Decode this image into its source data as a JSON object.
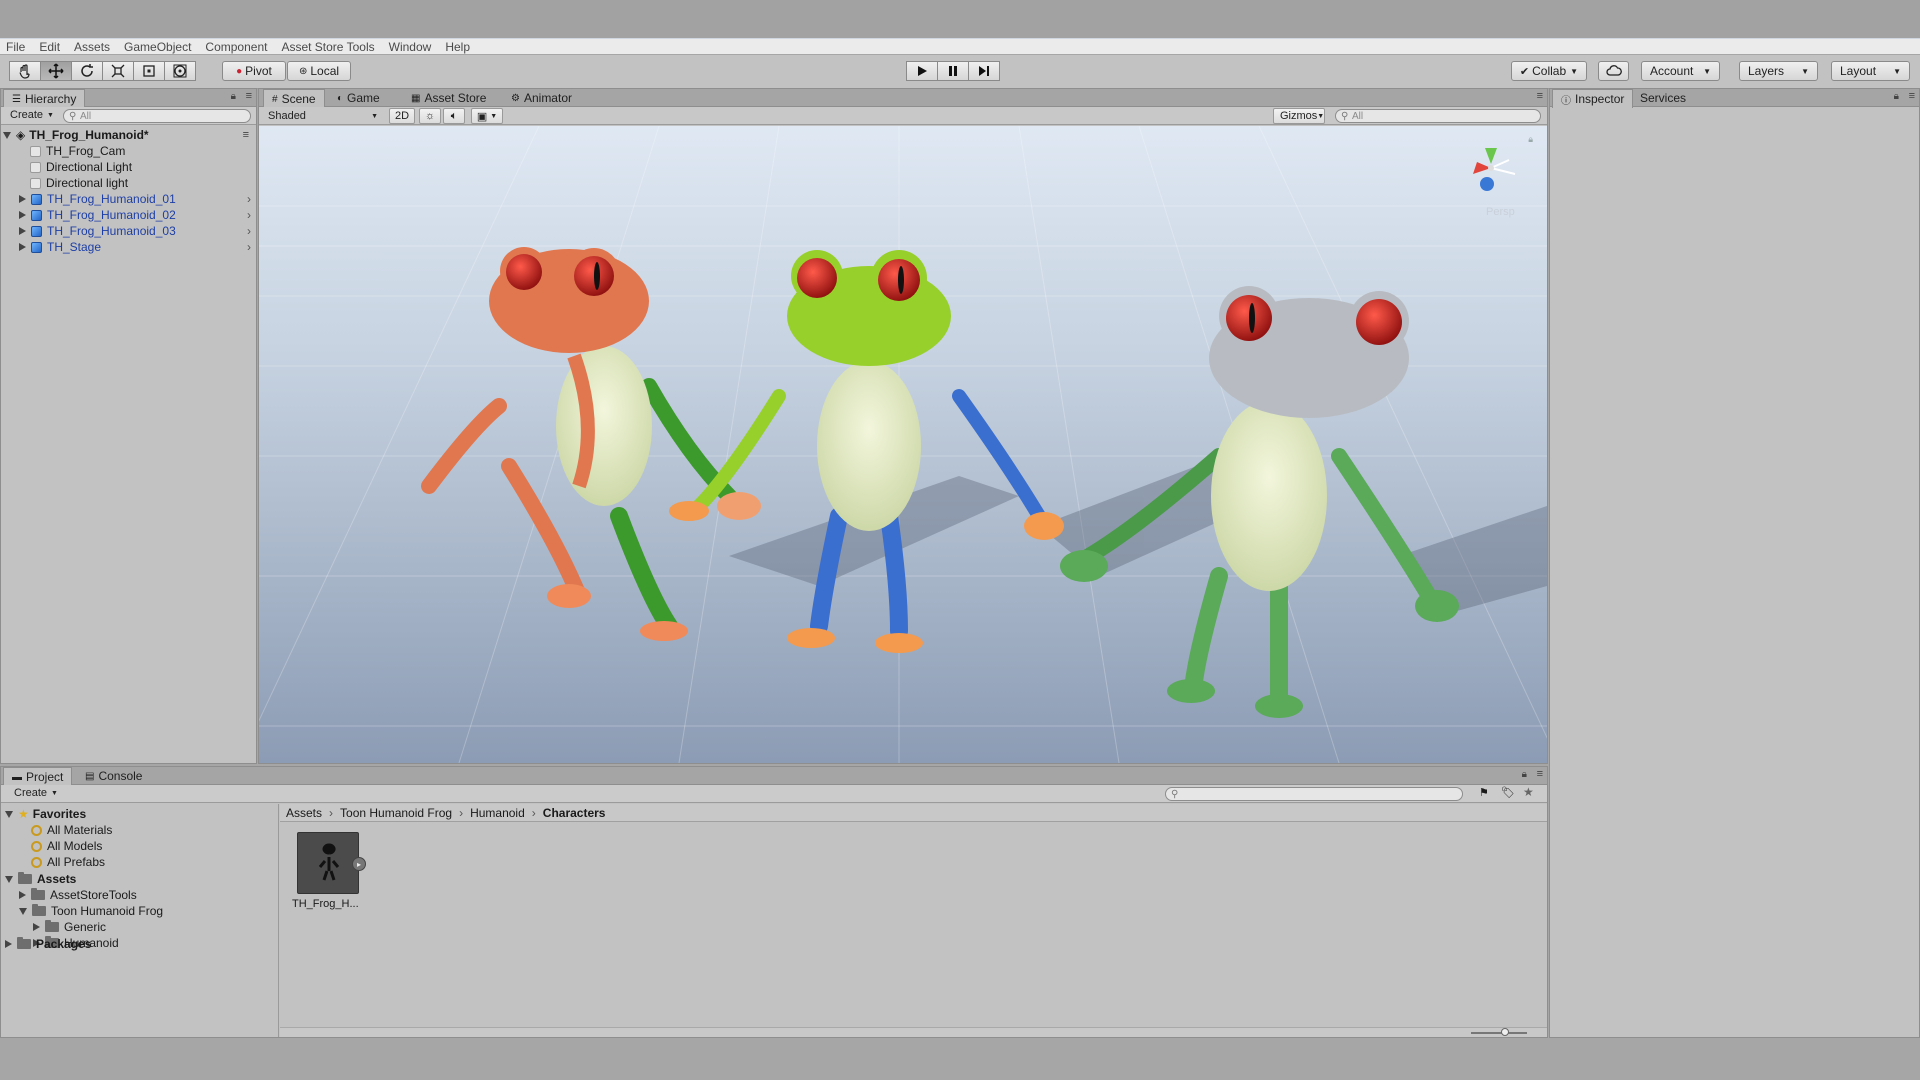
{
  "menu": [
    "File",
    "Edit",
    "Assets",
    "GameObject",
    "Component",
    "Asset Store Tools",
    "Window",
    "Help"
  ],
  "toolbar": {
    "pivot_label": "Pivot",
    "local_label": "Local",
    "collab_label": "Collab",
    "account_label": "Account",
    "layers_label": "Layers",
    "layout_label": "Layout"
  },
  "hierarchy": {
    "tab_label": "Hierarchy",
    "create_label": "Create",
    "search_placeholder": "All",
    "scene_name": "TH_Frog_Humanoid*",
    "items": [
      {
        "label": "TH_Frog_Cam",
        "type": "gameobject"
      },
      {
        "label": "Directional Light",
        "type": "gameobject"
      },
      {
        "label": "Directional light",
        "type": "gameobject"
      },
      {
        "label": "TH_Frog_Humanoid_01",
        "type": "prefab"
      },
      {
        "label": "TH_Frog_Humanoid_02",
        "type": "prefab"
      },
      {
        "label": "TH_Frog_Humanoid_03",
        "type": "prefab"
      },
      {
        "label": "TH_Stage",
        "type": "prefab"
      }
    ]
  },
  "scene": {
    "tabs": [
      "Scene",
      "Game",
      "Asset Store",
      "Animator"
    ],
    "shading_mode": "Shaded",
    "mode_2d": "2D",
    "gizmos_label": "Gizmos",
    "search_placeholder": "All",
    "persp_label": "Persp",
    "frog_colors": [
      "#e0774f",
      "#97d02a",
      "#b8bcc2"
    ]
  },
  "inspector": {
    "tabs": [
      "Inspector",
      "Services"
    ]
  },
  "project": {
    "tabs": [
      "Project",
      "Console"
    ],
    "create_label": "Create",
    "favorites_label": "Favorites",
    "favorites": [
      "All Materials",
      "All Models",
      "All Prefabs"
    ],
    "assets_label": "Assets",
    "asset_folders": [
      {
        "label": "AssetStoreTools",
        "depth": 1,
        "expanded": false
      },
      {
        "label": "Toon Humanoid Frog",
        "depth": 1,
        "expanded": true
      },
      {
        "label": "Generic",
        "depth": 2,
        "expanded": false
      },
      {
        "label": "Humanoid",
        "depth": 2,
        "expanded": false
      }
    ],
    "packages_label": "Packages",
    "breadcrumb": [
      "Assets",
      "Toon Humanoid Frog",
      "Humanoid",
      "Characters"
    ],
    "asset_item_label": "TH_Frog_H..."
  }
}
